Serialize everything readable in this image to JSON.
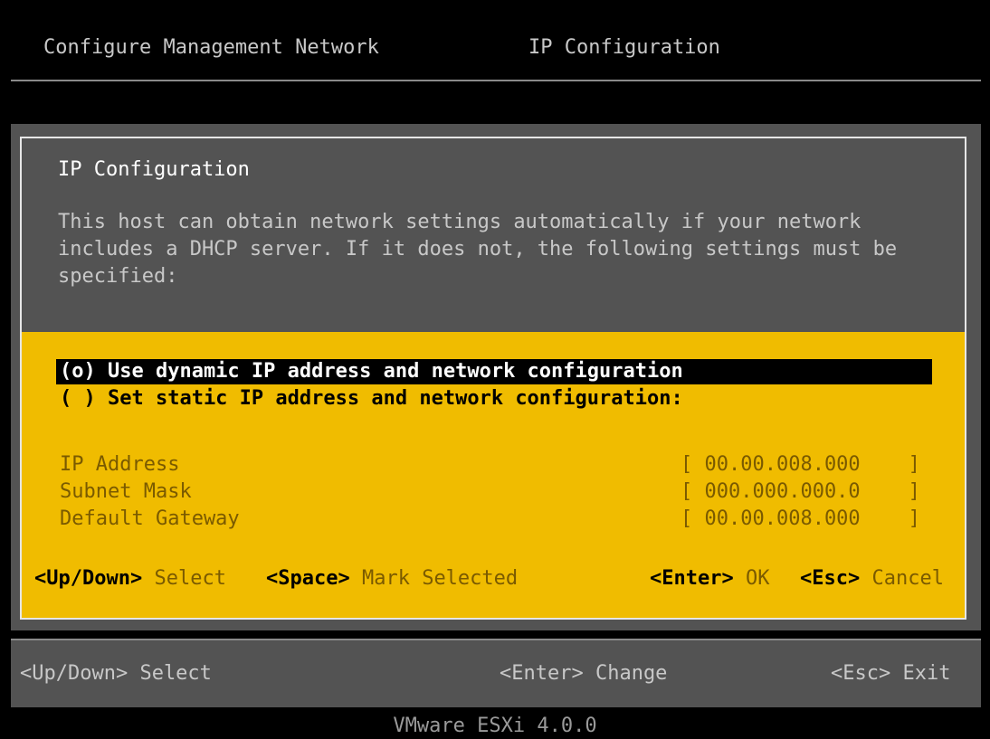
{
  "header": {
    "left": "Configure Management Network",
    "right": "IP Configuration"
  },
  "dialog": {
    "title": "IP Configuration",
    "description_lines": [
      "This host can obtain network settings automatically if your network",
      "includes a DHCP server. If it does not, the following settings must be",
      "specified:"
    ],
    "options": [
      {
        "label": "(o) Use dynamic IP address and network configuration",
        "selected": true
      },
      {
        "label": "( ) Set static IP address and network configuration:",
        "selected": false
      }
    ],
    "fields": [
      {
        "label": "IP Address",
        "value": "[ 00.00.008.000    ]"
      },
      {
        "label": "Subnet Mask",
        "value": "[ 000.000.000.0    ]"
      },
      {
        "label": "Default Gateway",
        "value": "[ 00.00.008.000    ]"
      }
    ],
    "hints": {
      "updown_key": "<Up/Down>",
      "updown_text": "Select",
      "space_key": "<Space>",
      "space_text": "Mark Selected",
      "enter_key": "<Enter>",
      "enter_text": "OK",
      "esc_key": "<Esc>",
      "esc_text": "Cancel"
    }
  },
  "bottom": {
    "select": "<Up/Down> Select",
    "change": "<Enter> Change",
    "exit": "<Esc> Exit"
  },
  "footer": {
    "version": "VMware ESXi 4.0.0"
  },
  "colors": {
    "background": "#000000",
    "panel": "#535353",
    "accent": "#f0bc00",
    "selected_bg": "#000000",
    "border": "#e6e6e6"
  }
}
